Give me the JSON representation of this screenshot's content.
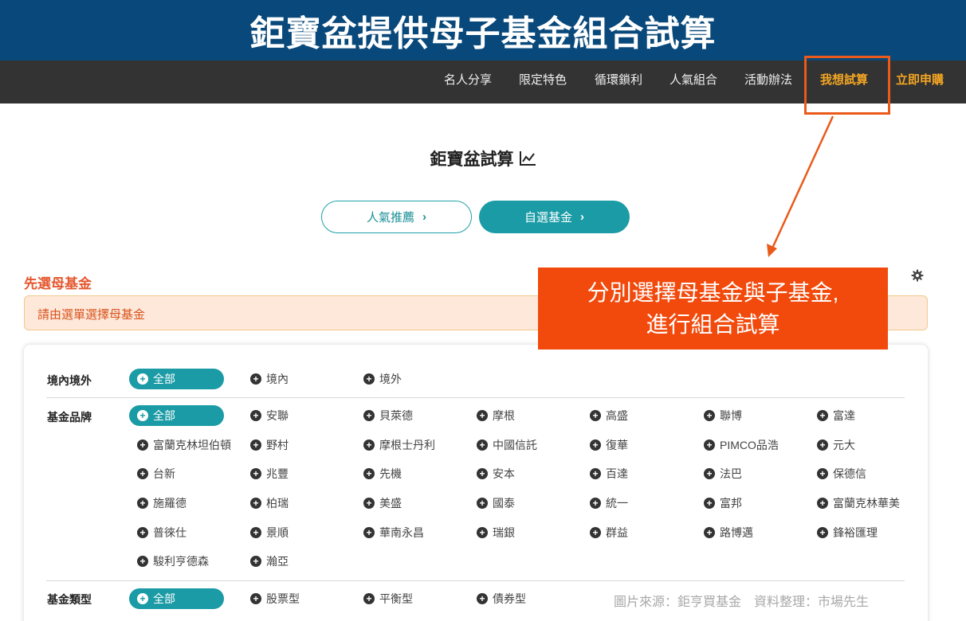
{
  "banner": {
    "title": "鉅寶盆提供母子基金組合試算"
  },
  "nav": {
    "items": [
      "名人分享",
      "限定特色",
      "循環鎖利",
      "人氣組合",
      "活動辦法"
    ],
    "try_calc": "我想試算",
    "apply_now": "立即申購"
  },
  "page": {
    "heading": "鉅寶盆試算",
    "pill_popular": "人氣推薦",
    "pill_custom": "自選基金",
    "section_title": "先選母基金",
    "alert": "請由選單選擇母基金"
  },
  "callout": {
    "line1": "分別選擇母基金與子基金,",
    "line2": "進行組合試算"
  },
  "filters": {
    "region": {
      "label": "境內境外",
      "options": [
        "全部",
        "境內",
        "境外"
      ],
      "selected": "全部"
    },
    "brand": {
      "label": "基金品牌",
      "options": [
        [
          "全部",
          "安聯",
          "貝萊德",
          "摩根",
          "高盛",
          "聯博",
          "富達"
        ],
        [
          "富蘭克林坦伯頓",
          "野村",
          "摩根士丹利",
          "中國信託",
          "復華",
          "PIMCO品浩",
          "元大"
        ],
        [
          "台新",
          "兆豐",
          "先機",
          "安本",
          "百達",
          "法巴",
          "保德信"
        ],
        [
          "施羅德",
          "柏瑞",
          "美盛",
          "國泰",
          "統一",
          "富邦",
          "富蘭克林華美"
        ],
        [
          "普徠仕",
          "景順",
          "華南永昌",
          "瑞銀",
          "群益",
          "路博邁",
          "鋒裕匯理"
        ],
        [
          "駿利亨德森",
          "瀚亞"
        ]
      ],
      "selected": "全部"
    },
    "type": {
      "label": "基金類型",
      "options": [
        "全部",
        "股票型",
        "平衡型",
        "債券型"
      ],
      "selected": "全部"
    }
  },
  "credit": "圖片來源：鉅亨買基金　資料整理：市場先生",
  "colors": {
    "banner": "#08487a",
    "navbar": "#333333",
    "accent_orange": "#f5a623",
    "teal": "#1a9ba5",
    "callout": "#f24a0c",
    "highlight": "#ea5a1a"
  }
}
